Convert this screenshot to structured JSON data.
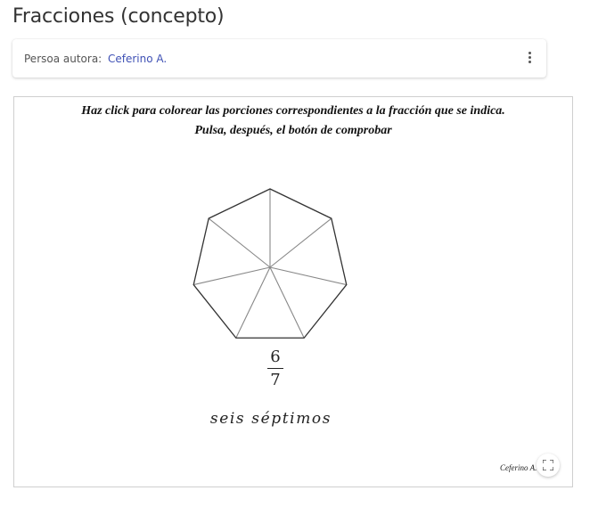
{
  "page": {
    "title": "Fracciones (concepto)"
  },
  "author_card": {
    "label": "Persoa autora:",
    "author_name": "Ceferino A.",
    "menu_icon": "more-vert-icon"
  },
  "applet": {
    "instruction_line1": "Haz click para colorear las porciones correspondientes a la fracción que se indica.",
    "instruction_line2": "Pulsa, después, el botón de comprobar",
    "shape": "heptagon",
    "total_sections": 7,
    "colored_sections": 0,
    "fraction": {
      "numerator": "6",
      "denominator": "7"
    },
    "fraction_words": "seis séptimos",
    "credit": "Ceferino A.",
    "fullscreen_icon": "fullscreen-icon"
  }
}
